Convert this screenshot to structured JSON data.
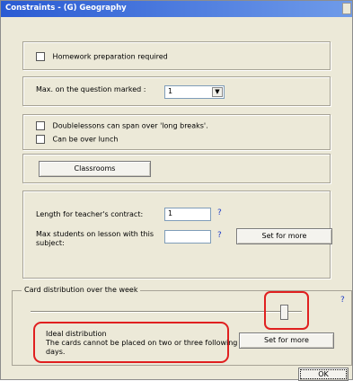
{
  "window": {
    "title": "Constraints - (G) Geography"
  },
  "homework": {
    "label": "Homework preparation required"
  },
  "max_marked": {
    "label": "Max. on the question marked :",
    "value": "1"
  },
  "breaks": {
    "doublelessons_label": "Doublelessons can span over 'long breaks'.",
    "lunch_label": "Can be over lunch"
  },
  "classrooms": {
    "button_label": "Classrooms"
  },
  "teacher": {
    "contract_label": "Length for teacher's contract:",
    "contract_value": "1",
    "contract_help": "?",
    "max_students_label_line1": "Max students on lesson with this",
    "max_students_label_line2": "subject:",
    "max_students_value": "",
    "max_students_help": "?",
    "set_for_more_label": "Set for more"
  },
  "distribution": {
    "group_label": "Card distribution over the week",
    "help": "?",
    "slider_level": 0.95,
    "title": "Ideal distribution",
    "description_line1": "The cards cannot be placed on two or three following",
    "description_line2": "days.",
    "set_for_more_label": "Set for more",
    "highlight_color": "#e02020"
  },
  "footer": {
    "ok_label": "OK"
  }
}
